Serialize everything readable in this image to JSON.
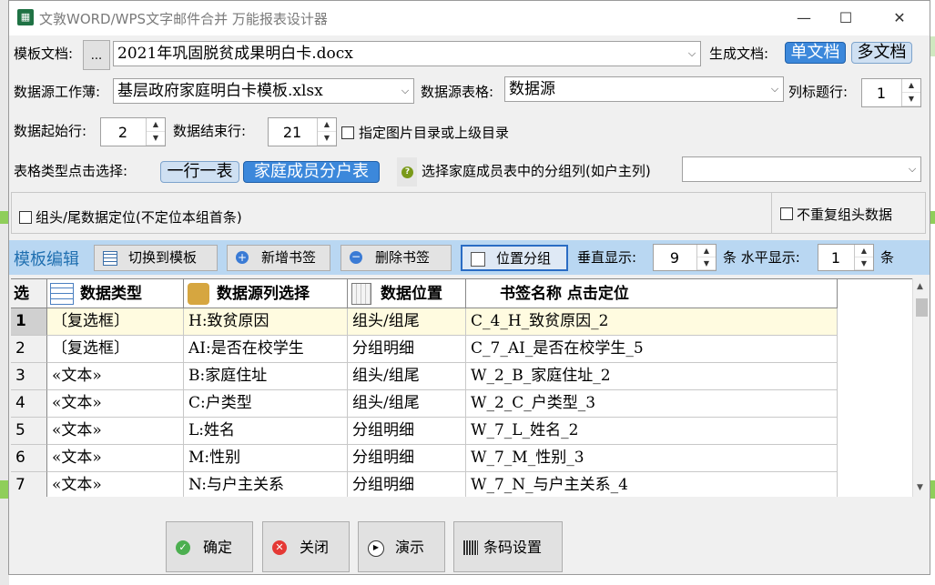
{
  "window": {
    "title": "文敦WORD/WPS文字邮件合并 万能报表设计器",
    "min_glyph": "—",
    "max_glyph": "☐",
    "close_glyph": "✕"
  },
  "template_doc": {
    "label": "模板文档:",
    "browse_label": "...",
    "value": "2021年巩固脱贫成果明白卡.docx"
  },
  "generate": {
    "label": "生成文档:",
    "single_label": "单文档",
    "multi_label": "多文档"
  },
  "datasource_book": {
    "label": "数据源工作薄:",
    "value": "基层政府家庭明白卡模板.xlsx"
  },
  "datasource_sheet": {
    "label": "数据源表格:",
    "value": "数据源"
  },
  "header_row": {
    "label": "列标题行:",
    "value": "1"
  },
  "data_start": {
    "label": "数据起始行:",
    "value": "2"
  },
  "data_end": {
    "label": "数据结束行:",
    "value": "21"
  },
  "image_dir_checkbox": {
    "label": "指定图片目录或上级目录"
  },
  "table_type": {
    "label": "表格类型点击选择:",
    "option_one_row": "一行一表",
    "option_family": "家庭成员分户表"
  },
  "group_column": {
    "label": "选择家庭成员表中的分组列(如户主列)",
    "value": ""
  },
  "group_head_checkbox": {
    "label": "组头/尾数据定位(不定位本组首条)"
  },
  "no_repeat_checkbox": {
    "label": "不重复组头数据"
  },
  "toolbar": {
    "title": "模板编辑",
    "switch_label": "切换到模板",
    "add_label": "新增书签",
    "delete_label": "删除书签",
    "position_label": "位置分组",
    "vertical_label": "垂直显示:",
    "vertical_value": "9",
    "horizontal_label": "条 水平显示:",
    "horizontal_value": "1",
    "unit_label": "条"
  },
  "table": {
    "columns": [
      "选",
      "数据类型",
      "数据源列选择",
      "数据位置",
      "书签名称 点击定位"
    ],
    "rows": [
      {
        "num": "1",
        "type": "〔复选框〕",
        "source": "H:致贫原因",
        "position": "组头/组尾",
        "bookmark": "C_4_H_致贫原因_2"
      },
      {
        "num": "2",
        "type": "〔复选框〕",
        "source": "AI:是否在校学生",
        "position": "分组明细",
        "bookmark": "C_7_AI_是否在校学生_5"
      },
      {
        "num": "3",
        "type": "«文本»",
        "source": "B:家庭住址",
        "position": "组头/组尾",
        "bookmark": "W_2_B_家庭住址_2"
      },
      {
        "num": "4",
        "type": "«文本»",
        "source": "C:户类型",
        "position": "组头/组尾",
        "bookmark": "W_2_C_户类型_3"
      },
      {
        "num": "5",
        "type": "«文本»",
        "source": "L:姓名",
        "position": "分组明细",
        "bookmark": "W_7_L_姓名_2"
      },
      {
        "num": "6",
        "type": "«文本»",
        "source": "M:性别",
        "position": "分组明细",
        "bookmark": "W_7_M_性别_3"
      },
      {
        "num": "7",
        "type": "«文本»",
        "source": "N:与户主关系",
        "position": "分组明细",
        "bookmark": "W_7_N_与户主关系_4"
      }
    ]
  },
  "buttons": {
    "ok_label": "确定",
    "close_label": "关闭",
    "demo_label": "演示",
    "barcode_label": "条码设置"
  },
  "colors": {
    "accent": "#3c88db",
    "toolbar_bg": "#b9d7f2",
    "selected_row": "#fffbe0"
  }
}
